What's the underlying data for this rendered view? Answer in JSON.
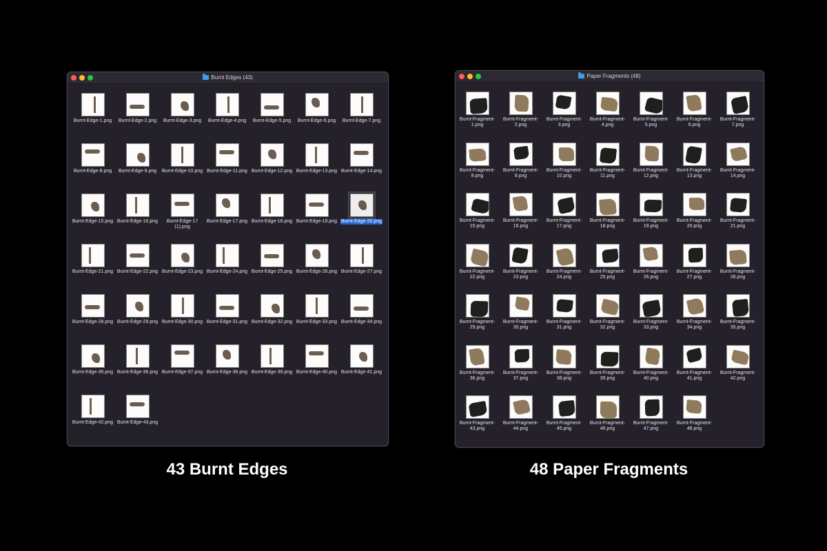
{
  "left_window": {
    "title": "Burnt Edges (43)",
    "selected_index": 20,
    "files": [
      "Burnt-Edge-1.png",
      "Burnt-Edge-2.png",
      "Burnt-Edge-3.png",
      "Burnt-Edge-4.png",
      "Burnt-Edge-5.png",
      "Burnt-Edge-6.png",
      "Burnt-Edge-7.png",
      "Burnt-Edge-8.png",
      "Burnt-Edge-9.png",
      "Burnt-Edge-10.png",
      "Burnt-Edge-11.png",
      "Burnt-Edge-12.png",
      "Burnt-Edge-13.png",
      "Burnt-Edge-14.png",
      "Burnt-Edge-15.png",
      "Burnt-Edge-16.png",
      "Burnt-Edge-17 (1).png",
      "Burnt-Edge-17.png",
      "Burnt-Edge-18.png",
      "Burnt-Edge-19.png",
      "Burnt-Edge-20.png",
      "Burnt-Edge-21.png",
      "Burnt-Edge-22.png",
      "Burnt-Edge-23.png",
      "Burnt-Edge-24.png",
      "Burnt-Edge-25.png",
      "Burnt-Edge-26.png",
      "Burnt-Edge-27.png",
      "Burnt-Edge-28.png",
      "Burnt-Edge-29.png",
      "Burnt-Edge-30.png",
      "Burnt-Edge-31.png",
      "Burnt-Edge-32.png",
      "Burnt-Edge-33.png",
      "Burnt-Edge-34.png",
      "Burnt-Edge-35.png",
      "Burnt-Edge-36.png",
      "Burnt-Edge-37.png",
      "Burnt-Edge-38.png",
      "Burnt-Edge-39.png",
      "Burnt-Edge-40.png",
      "Burnt-Edge-41.png",
      "Burnt-Edge-42.png",
      "Burnt-Edge-43.png"
    ]
  },
  "right_window": {
    "title": "Paper Fragments (48)",
    "files": [
      "Burnt-Fragment-1.png",
      "Burnt-Fragment-2.png",
      "Burnt-Fragment-3.png",
      "Burnt-Fragment-4.png",
      "Burnt-Fragment-5.png",
      "Burnt-Fragment-6.png",
      "Burnt-Fragment-7.png",
      "Burnt-Fragment-8.png",
      "Burnt-Fragment-9.png",
      "Burnt-Fragment-10.png",
      "Burnt-Fragment-11.png",
      "Burnt-Fragment-12.png",
      "Burnt-Fragment-13.png",
      "Burnt-Fragment-14.png",
      "Burnt-Fragment-15.png",
      "Burnt-Fragment-16.png",
      "Burnt-Fragment-17.png",
      "Burnt-Fragment-18.png",
      "Burnt-Fragment-19.png",
      "Burnt-Fragment-20.png",
      "Burnt-Fragment-21.png",
      "Burnt-Fragment-22.png",
      "Burnt-Fragment-23.png",
      "Burnt-Fragment-24.png",
      "Burnt-Fragment-25.png",
      "Burnt-Fragment-26.png",
      "Burnt-Fragment-27.png",
      "Burnt-Fragment-28.png",
      "Burnt-Fragment-29.png",
      "Burnt-Fragment-30.png",
      "Burnt-Fragment-31.png",
      "Burnt-Fragment-32.png",
      "Burnt-Fragment-33.png",
      "Burnt-Fragment-34.png",
      "Burnt-Fragment-35.png",
      "Burnt-Fragment-36.png",
      "Burnt-Fragment-37.png",
      "Burnt-Fragment-38.png",
      "Burnt-Fragment-39.png",
      "Burnt-Fragment-40.png",
      "Burnt-Fragment-41.png",
      "Burnt-Fragment-42.png",
      "Burnt-Fragment-43.png",
      "Burnt-Fragment-44.png",
      "Burnt-Fragment-45.png",
      "Burnt-Fragment-46.png",
      "Burnt-Fragment-47.png",
      "Burnt-Fragment-48.png"
    ]
  },
  "captions": {
    "left": "43 Burnt Edges",
    "right": "48 Paper Fragments"
  },
  "colors": {
    "window_bg": "#25212a",
    "selection": "#2566d6",
    "burnt": "#3a2a18",
    "fragment_dark": "#1e1f1e",
    "fragment_tan": "#8f7a5e"
  }
}
